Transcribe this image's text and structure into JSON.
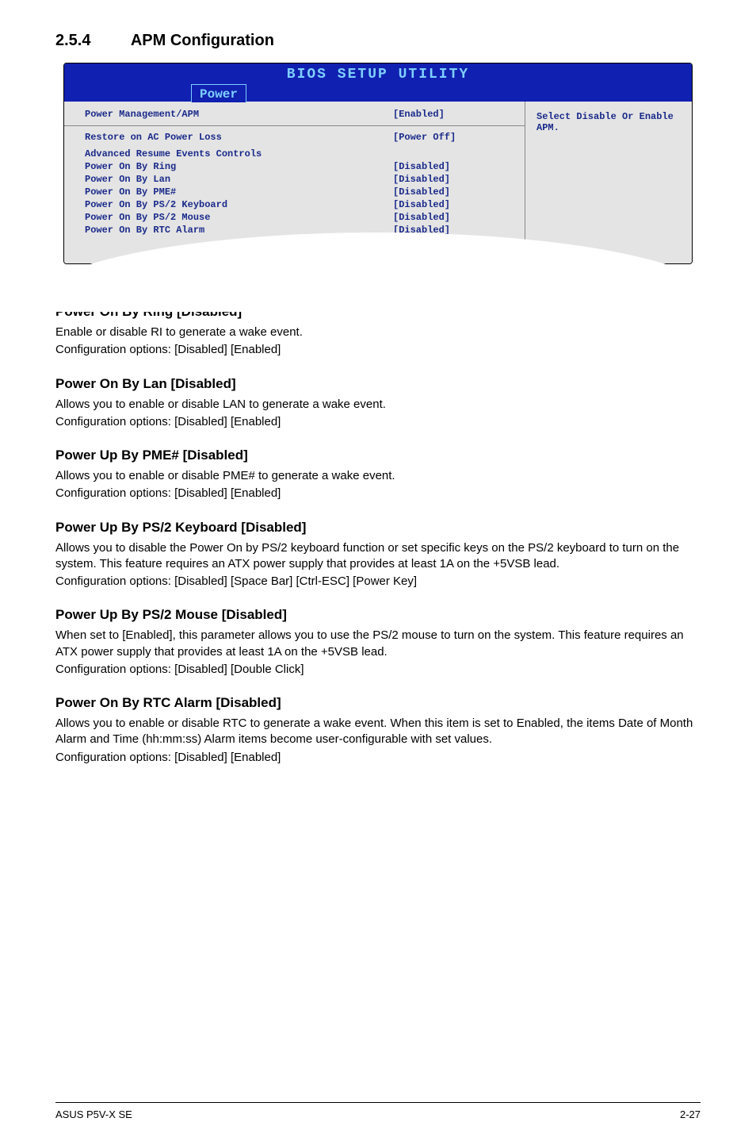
{
  "section": {
    "number": "2.5.4",
    "title": "APM Configuration"
  },
  "bios": {
    "headerTitle": "BIOS SETUP UTILITY",
    "tab": "Power",
    "help": "Select Disable Or Enable APM.",
    "topRow": {
      "label": "Power Management/APM",
      "value": "[Enabled]"
    },
    "restoreRow": {
      "label": "Restore on AC Power Loss",
      "value": "[Power Off]"
    },
    "advHeading": "Advanced Resume Events Controls",
    "rows": [
      {
        "label": "Power On By Ring",
        "value": "[Disabled]"
      },
      {
        "label": "Power On By Lan",
        "value": "[Disabled]"
      },
      {
        "label": "Power On By PME#",
        "value": "[Disabled]"
      },
      {
        "label": "Power On By PS/2 Keyboard",
        "value": "[Disabled]"
      },
      {
        "label": "Power On By PS/2 Mouse",
        "value": "[Disabled]"
      },
      {
        "label": "Power On By RTC Alarm",
        "value": "[Disabled]"
      }
    ]
  },
  "items": [
    {
      "heading": "Power On By Ring [Disabled]",
      "body1": "Enable or disable RI to generate a wake event.",
      "body2": "Configuration options: [Disabled] [Enabled]"
    },
    {
      "heading": "Power On By Lan [Disabled]",
      "body1": "Allows you to enable or disable LAN to generate a wake event.",
      "body2": "Configuration options: [Disabled] [Enabled]"
    },
    {
      "heading": "Power Up By PME# [Disabled]",
      "body1": "Allows you to enable or disable PME# to generate a wake event.",
      "body2": "Configuration options: [Disabled] [Enabled]"
    },
    {
      "heading": "Power Up By PS/2 Keyboard [Disabled]",
      "body1": "Allows you to disable the Power On by PS/2 keyboard function or set specific keys on the PS/2 keyboard to turn on the system. This feature requires an ATX power supply that provides at least 1A on the +5VSB lead.",
      "body2": "Configuration options: [Disabled] [Space Bar] [Ctrl-ESC] [Power Key]"
    },
    {
      "heading": "Power Up By PS/2 Mouse [Disabled]",
      "body1": "When set to [Enabled], this parameter allows you to use the PS/2 mouse to turn on the system. This feature requires an ATX power supply that provides at least 1A on the +5VSB lead.",
      "body2": "Configuration options: [Disabled] [Double Click]"
    },
    {
      "heading": "Power On By RTC Alarm [Disabled]",
      "body1": "Allows you to enable or disable RTC to generate a wake event. When this item is set to Enabled, the items Date of Month Alarm and Time (hh:mm:ss) Alarm items become user-configurable with set values.",
      "body2": "Configuration options: [Disabled] [Enabled]"
    }
  ],
  "footer": {
    "left": "ASUS P5V-X SE",
    "right": "2-27"
  }
}
